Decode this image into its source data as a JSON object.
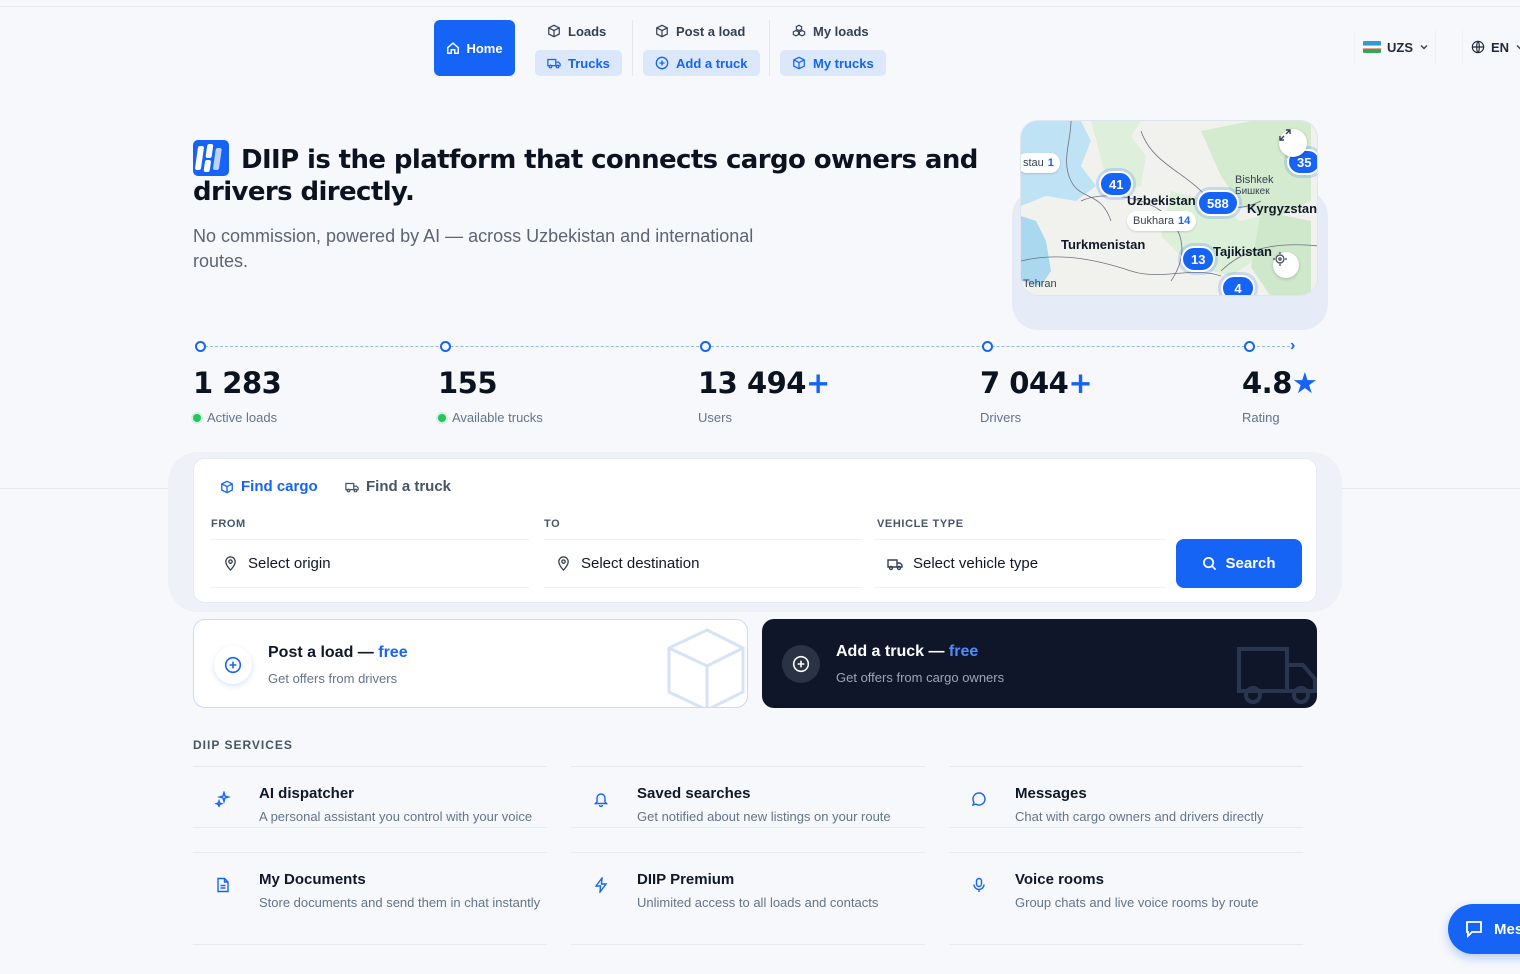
{
  "nav": {
    "home": "Home",
    "loads": "Loads",
    "trucks": "Trucks",
    "post_load": "Post a load",
    "add_truck": "Add a truck",
    "my_loads": "My loads",
    "my_trucks": "My trucks",
    "currency": "UZS",
    "language": "EN"
  },
  "hero": {
    "title": "DIIP is the platform that connects cargo owners and drivers directly.",
    "subtitle": "No commission, powered by AI — across Uzbekistan and international routes."
  },
  "map": {
    "labels": [
      "Uzbekistan",
      "Kyrgyzstan",
      "Turkmenistan",
      "Tajikistan",
      "Bishkek",
      "Бишкек",
      "Tehran",
      "Bukhara",
      "stau"
    ],
    "clusters": [
      "41",
      "588",
      "13",
      "4",
      "35"
    ],
    "chips": [
      {
        "name": "stau",
        "count": "1"
      },
      {
        "name": "Bukhara",
        "count": "14"
      }
    ]
  },
  "stats": [
    {
      "value": "1 283",
      "plus": "",
      "label": "Active loads",
      "live": true
    },
    {
      "value": "155",
      "plus": "",
      "label": "Available trucks",
      "live": true
    },
    {
      "value": "13 494",
      "plus": "+",
      "label": "Users",
      "live": false
    },
    {
      "value": "7 044",
      "plus": "+",
      "label": "Drivers",
      "live": false
    },
    {
      "value": "4.8",
      "plus": "★",
      "label": "Rating",
      "live": false
    }
  ],
  "search": {
    "tab_cargo": "Find cargo",
    "tab_truck": "Find a truck",
    "from_label": "FROM",
    "to_label": "TO",
    "vehicle_label": "VEHICLE TYPE",
    "from_placeholder": "Select origin",
    "to_placeholder": "Select destination",
    "vehicle_placeholder": "Select vehicle type",
    "button": "Search"
  },
  "cta": {
    "post_title": "Post a load —",
    "post_free": "free",
    "post_sub": "Get offers from drivers",
    "truck_title": "Add a truck —",
    "truck_free": "free",
    "truck_sub": "Get offers from cargo owners"
  },
  "services": {
    "heading": "DIIP SERVICES",
    "items": [
      {
        "title": "AI dispatcher",
        "desc": "A personal assistant you control with your voice",
        "icon": "sparkle-icon"
      },
      {
        "title": "Saved searches",
        "desc": "Get notified about new listings on your route",
        "icon": "bell-icon"
      },
      {
        "title": "Messages",
        "desc": "Chat with cargo owners and drivers directly",
        "icon": "chat-bubble-icon"
      },
      {
        "title": "My Documents",
        "desc": "Store documents and send them in chat instantly",
        "icon": "document-icon"
      },
      {
        "title": "DIIP Premium",
        "desc": "Unlimited access to all loads and contacts",
        "icon": "lightning-icon"
      },
      {
        "title": "Voice rooms",
        "desc": "Group chats and live voice rooms by route",
        "icon": "microphone-icon"
      }
    ]
  },
  "chat_fab": "Mes",
  "colors": {
    "accent": "#1664f5",
    "dark_card": "#0f1629",
    "live_dot": "#22c55e"
  }
}
